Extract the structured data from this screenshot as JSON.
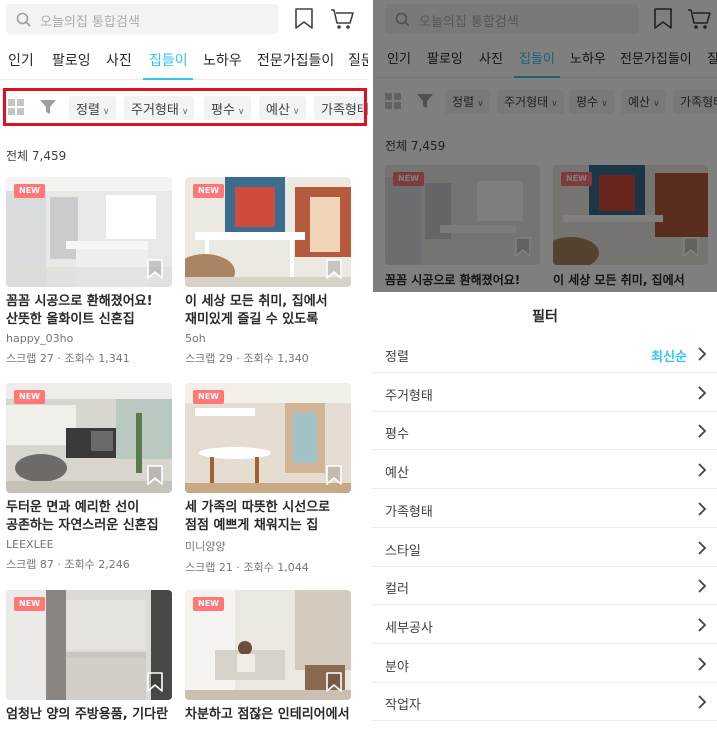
{
  "search": {
    "placeholder": "오늘의집 통합검색"
  },
  "tabs": [
    {
      "label": "인기"
    },
    {
      "label": "팔로잉"
    },
    {
      "label": "사진"
    },
    {
      "label": "집들이",
      "active": true
    },
    {
      "label": "노하우"
    },
    {
      "label": "전문가집들이"
    },
    {
      "label": "질문"
    }
  ],
  "filters": [
    {
      "label": "정렬"
    },
    {
      "label": "주거형태"
    },
    {
      "label": "평수"
    },
    {
      "label": "예산"
    },
    {
      "label": "가족형태"
    }
  ],
  "total": "전체 7,459",
  "new_badge": "NEW",
  "cards": [
    {
      "title": "꼼꼼 시공으로 환해졌어요! 산뜻한 올화이트 신혼집",
      "user": "happy_03ho",
      "stats": "스크랩 27 · 조회수 1,341",
      "is_new": true
    },
    {
      "title": "이 세상 모든 취미, 집에서 재미있게 즐길 수 있도록",
      "user": "5oh",
      "stats": "스크랩 29 · 조회수 1,340",
      "is_new": true
    },
    {
      "title": "두터운 면과 예리한 선이 공존하는 자연스러운 신혼집",
      "user": "LEEXLEE",
      "stats": "스크랩 87 · 조회수 2,246",
      "is_new": true
    },
    {
      "title": "세 가족의 따뜻한 시선으로 점점 예쁘게 채워지는 집",
      "user": "미니양양",
      "stats": "스크랩 21 · 조회수 1,044",
      "is_new": true
    },
    {
      "title": "엄청난 양의 주방용품, 기다란",
      "user": "",
      "stats": "",
      "is_new": true
    },
    {
      "title": "차분하고 점잖은 인테리어에서",
      "user": "",
      "stats": "",
      "is_new": true
    }
  ],
  "right": {
    "tabs": [
      "인기",
      "팔로잉",
      "사진",
      "집들이",
      "노하우",
      "전문가집들이",
      "질문"
    ],
    "filters": [
      "정렬",
      "주거형태",
      "평수",
      "예산",
      "가족형태"
    ],
    "total": "전체 7,459",
    "cards": [
      {
        "title": "꼼꼼 시공으로 환해졌어요!"
      },
      {
        "title": "이 세상 모든 취미, 집에서"
      }
    ],
    "sheet": {
      "title": "필터",
      "rows": [
        {
          "label": "정렬",
          "value": "최신순"
        },
        {
          "label": "주거형태",
          "value": ""
        },
        {
          "label": "평수",
          "value": ""
        },
        {
          "label": "예산",
          "value": ""
        },
        {
          "label": "가족형태",
          "value": ""
        },
        {
          "label": "스타일",
          "value": ""
        },
        {
          "label": "컬러",
          "value": ""
        },
        {
          "label": "세부공사",
          "value": ""
        },
        {
          "label": "분야",
          "value": ""
        },
        {
          "label": "작업자",
          "value": ""
        }
      ]
    }
  },
  "colors": {
    "accent": "#35c5f0",
    "new_badge": "#ff7777",
    "highlight_box": "#e0101e"
  },
  "icons": [
    "search-icon",
    "bookmark-icon",
    "cart-icon",
    "grid-view-icon",
    "filter-icon",
    "chevron-down-icon",
    "chevron-right-icon"
  ]
}
